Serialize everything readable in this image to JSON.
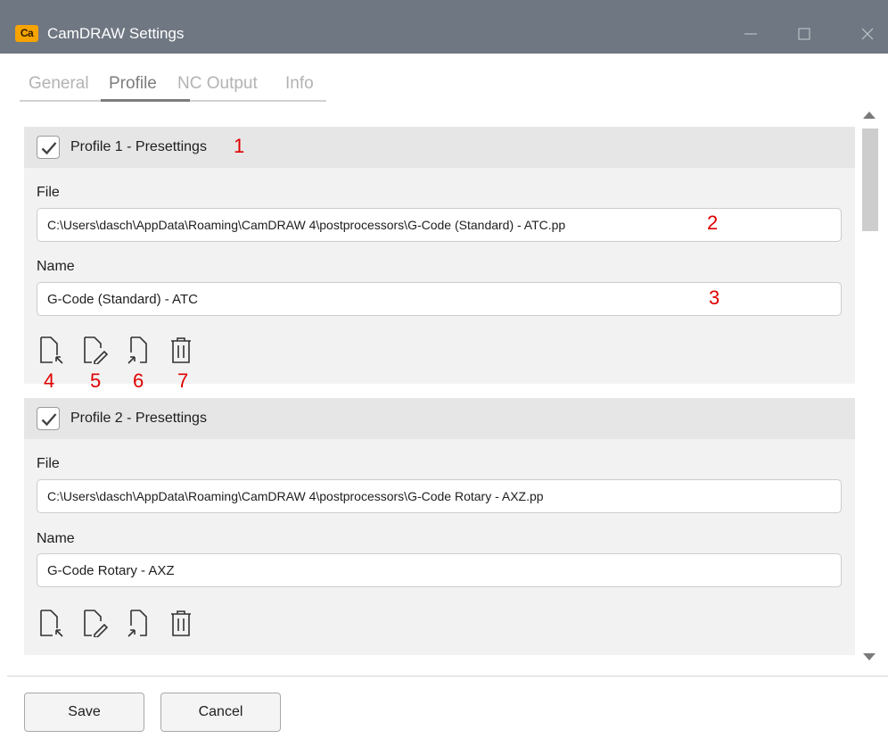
{
  "window": {
    "app_icon_text": "Ca",
    "title": "CamDRAW Settings",
    "controls": [
      "minimize-icon",
      "maximize-icon",
      "close-icon"
    ]
  },
  "tabs": [
    "General",
    "Profile",
    "NC Output",
    "Info"
  ],
  "active_tab": "Profile",
  "profiles": [
    {
      "checked": true,
      "title": "Profile 1 - Presettings",
      "file_label": "File",
      "file_value": "C:\\Users\\dasch\\AppData\\Roaming\\CamDRAW 4\\postprocessors\\G-Code (Standard) - ATC.pp",
      "name_label": "Name",
      "name_value": "G-Code (Standard) - ATC",
      "actions": [
        "import-file-icon",
        "edit-file-icon",
        "export-file-icon",
        "trash-icon"
      ]
    },
    {
      "checked": true,
      "title": "Profile 2 - Presettings",
      "file_label": "File",
      "file_value": "C:\\Users\\dasch\\AppData\\Roaming\\CamDRAW 4\\postprocessors\\G-Code Rotary - AXZ.pp",
      "name_label": "Name",
      "name_value": "G-Code Rotary - AXZ",
      "actions": [
        "import-file-icon",
        "edit-file-icon",
        "export-file-icon",
        "trash-icon"
      ]
    }
  ],
  "annotations": [
    "1",
    "2",
    "3",
    "4",
    "5",
    "6",
    "7"
  ],
  "buttons": {
    "save": "Save",
    "cancel": "Cancel"
  },
  "colors": {
    "titlebar": "#6f7782",
    "app_icon": "#f7a300",
    "annotation": "#e00000",
    "card": "#f2f2f2",
    "card_header": "#e6e6e6"
  }
}
